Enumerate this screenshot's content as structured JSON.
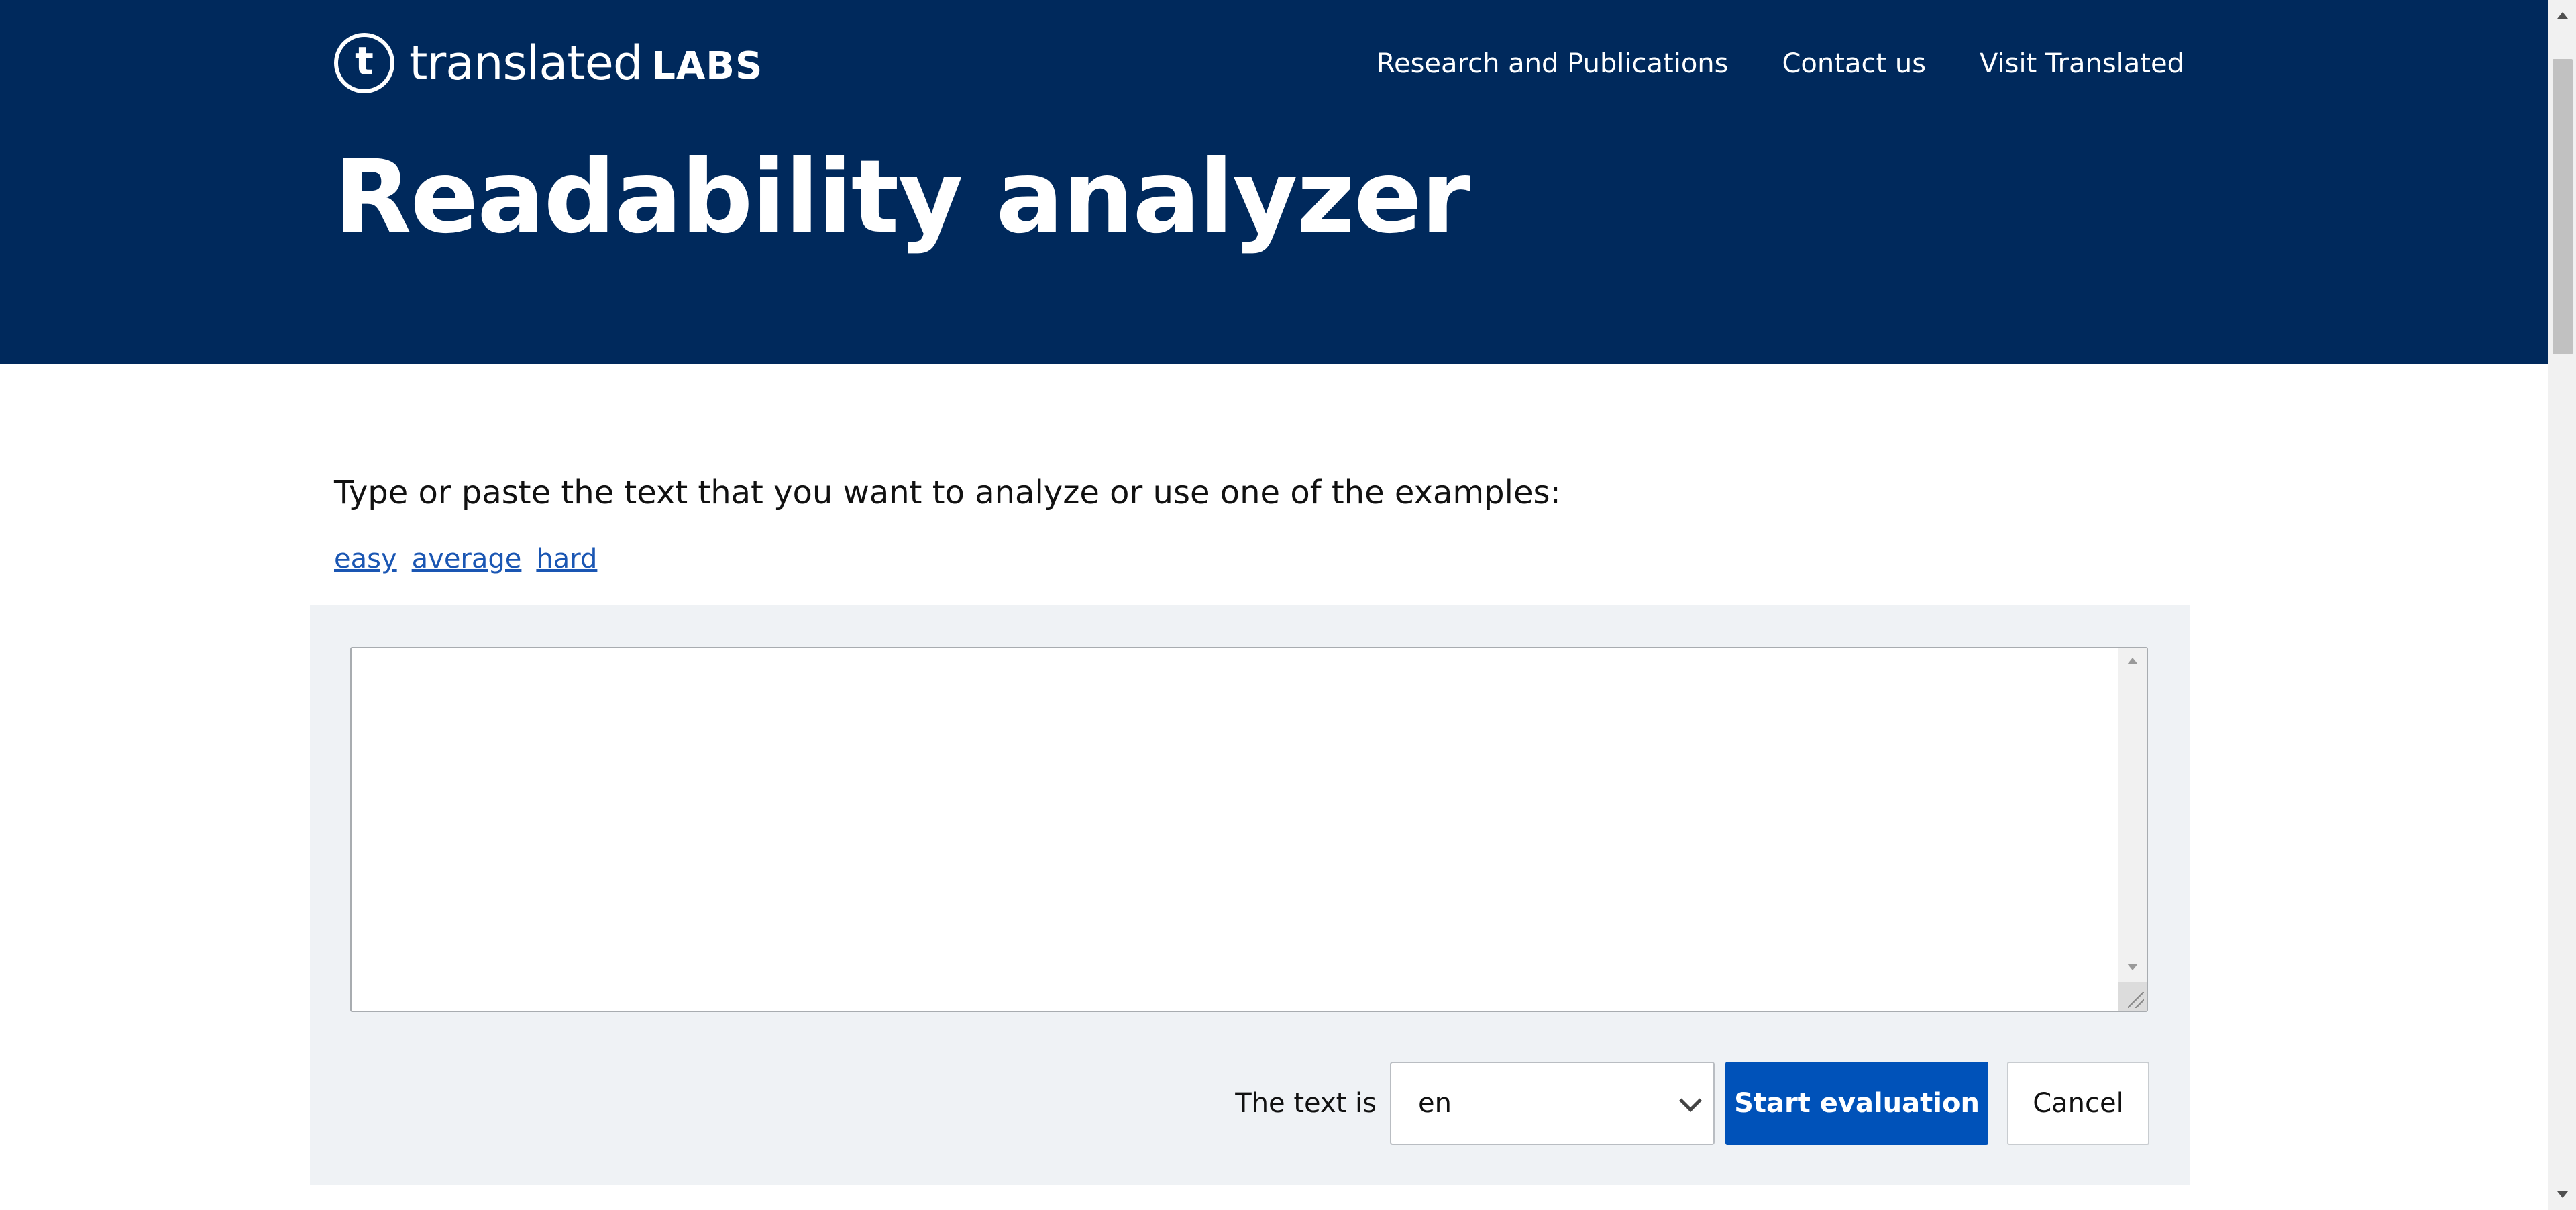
{
  "header": {
    "logo": {
      "mark": "t",
      "wordmark": "translated",
      "labs": "LABS"
    },
    "nav": [
      "Research and Publications",
      "Contact us",
      "Visit Translated"
    ],
    "title": "Readability analyzer"
  },
  "intro": {
    "instruction": "Type or paste the text that you want to analyze or use one of the examples:",
    "examples": [
      "easy",
      "average",
      "hard"
    ]
  },
  "form": {
    "text_value": "",
    "language_label": "The text is",
    "language_value": "en",
    "submit_label": "Start evaluation",
    "cancel_label": "Cancel"
  },
  "colors": {
    "header_bg": "#00295c",
    "panel_bg": "#eff2f5",
    "primary_button": "#0052b9",
    "link": "#1a56b3"
  },
  "icons": [
    "chevron-down-icon",
    "resize-grip-icon",
    "scroll-up-arrow-icon",
    "scroll-down-arrow-icon"
  ]
}
